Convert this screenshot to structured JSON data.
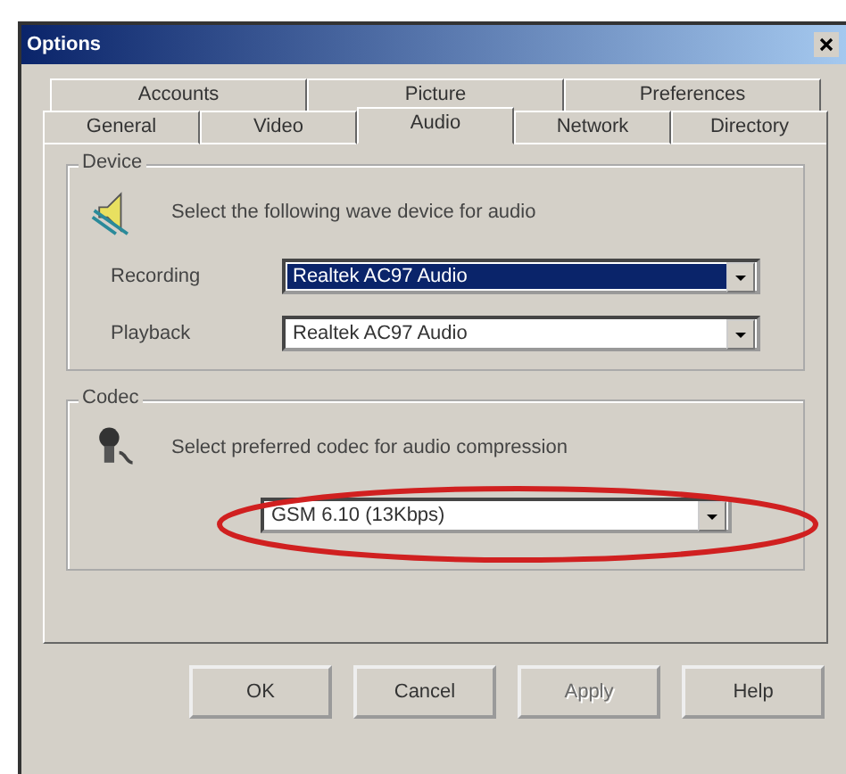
{
  "window": {
    "title": "Options"
  },
  "tab_rows": [
    [
      {
        "label": "Accounts",
        "selected": false
      },
      {
        "label": "Picture",
        "selected": false
      },
      {
        "label": "Preferences",
        "selected": false
      }
    ],
    [
      {
        "label": "General",
        "selected": false
      },
      {
        "label": "Video",
        "selected": false
      },
      {
        "label": "Audio",
        "selected": true
      },
      {
        "label": "Network",
        "selected": false
      },
      {
        "label": "Directory",
        "selected": false
      }
    ]
  ],
  "device_group": {
    "title": "Device",
    "description": "Select the following wave device for audio",
    "fields": [
      {
        "label": "Recording",
        "value": "Realtek AC97 Audio",
        "focused": true
      },
      {
        "label": "Playback",
        "value": "Realtek AC97 Audio",
        "focused": false
      }
    ]
  },
  "codec_group": {
    "title": "Codec",
    "description": "Select preferred codec for audio compression",
    "value": "GSM 6.10 (13Kbps)",
    "circled": true
  },
  "buttons": [
    {
      "label": "OK",
      "disabled": false
    },
    {
      "label": "Cancel",
      "disabled": false
    },
    {
      "label": "Apply",
      "disabled": true
    },
    {
      "label": "Help",
      "disabled": false
    }
  ]
}
